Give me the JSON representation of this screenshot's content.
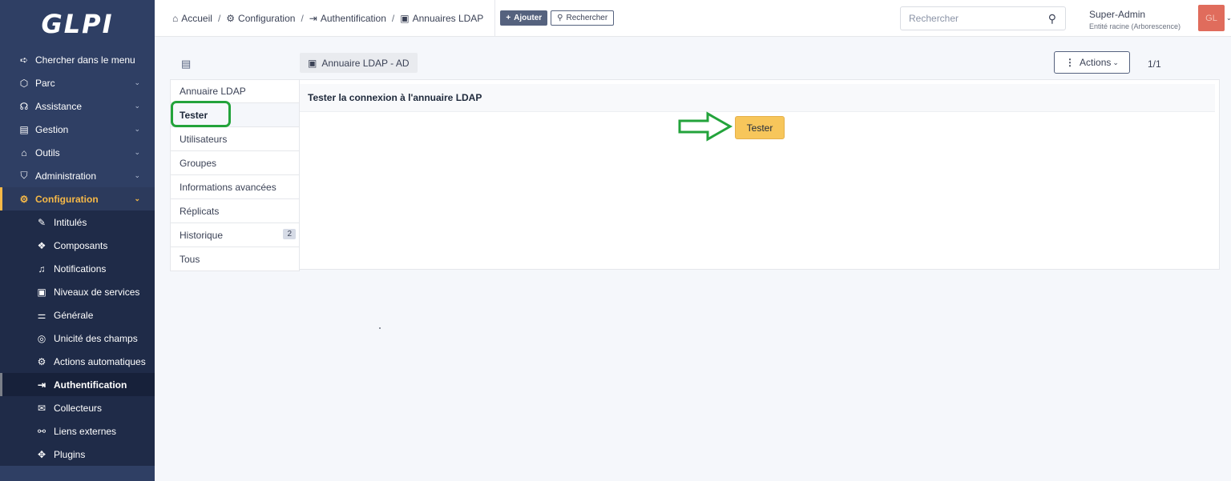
{
  "sidebar": {
    "logo": "GLPI",
    "items": [
      {
        "label": "Chercher dans le menu",
        "icon": "➪"
      },
      {
        "label": "Parc",
        "icon": "⬡"
      },
      {
        "label": "Assistance",
        "icon": "☊"
      },
      {
        "label": "Gestion",
        "icon": "▤"
      },
      {
        "label": "Outils",
        "icon": "⌂"
      },
      {
        "label": "Administration",
        "icon": "⛉"
      },
      {
        "label": "Configuration",
        "icon": "⚙"
      }
    ],
    "submenu": [
      {
        "label": "Intitulés",
        "icon": "✎"
      },
      {
        "label": "Composants",
        "icon": "❖"
      },
      {
        "label": "Notifications",
        "icon": "♫"
      },
      {
        "label": "Niveaux de services",
        "icon": "▣"
      },
      {
        "label": "Générale",
        "icon": "⚌"
      },
      {
        "label": "Unicité des champs",
        "icon": "◎"
      },
      {
        "label": "Actions automatiques",
        "icon": "⚙"
      },
      {
        "label": "Authentification",
        "icon": "⇥"
      },
      {
        "label": "Collecteurs",
        "icon": "✉"
      },
      {
        "label": "Liens externes",
        "icon": "⚯"
      },
      {
        "label": "Plugins",
        "icon": "✥"
      }
    ]
  },
  "breadcrumb": {
    "items": [
      {
        "label": "Accueil",
        "icon": "⌂"
      },
      {
        "label": "Configuration",
        "icon": "⚙"
      },
      {
        "label": "Authentification",
        "icon": "⇥"
      },
      {
        "label": "Annuaires LDAP",
        "icon": "▣"
      }
    ],
    "separator": "/"
  },
  "toolbar": {
    "add_label": "Ajouter",
    "search_label": "Rechercher"
  },
  "global_search": {
    "placeholder": "Rechercher"
  },
  "user": {
    "name": "Super-Admin",
    "entity": "Entité racine (Arborescence)",
    "initials": "GL"
  },
  "object": {
    "title": "Annuaire LDAP - AD",
    "actions_label": "Actions",
    "pager": "1/1"
  },
  "tabs": [
    {
      "label": "Annuaire LDAP"
    },
    {
      "label": "Tester"
    },
    {
      "label": "Utilisateurs"
    },
    {
      "label": "Groupes"
    },
    {
      "label": "Informations avancées"
    },
    {
      "label": "Réplicats"
    },
    {
      "label": "Historique",
      "badge": "2"
    },
    {
      "label": "Tous"
    }
  ],
  "panel": {
    "header": "Tester la connexion à l'annuaire LDAP",
    "button_label": "Tester"
  },
  "colors": {
    "sidebar_bg": "#2f3f64",
    "accent": "#f7b947",
    "button_yellow": "#f7c65b",
    "highlight_green": "#23a33b"
  }
}
